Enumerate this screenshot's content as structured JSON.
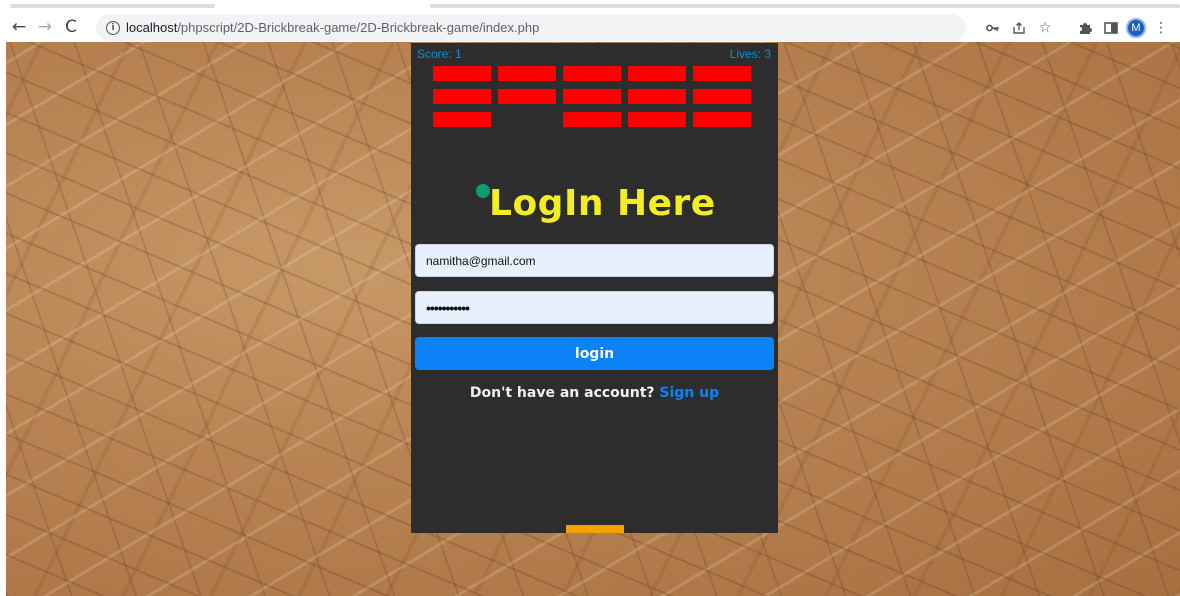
{
  "browser": {
    "icons": {
      "back": "arrow-left-icon",
      "forward": "arrow-right-icon",
      "reload": "reload-icon",
      "site_info": "info-icon",
      "password": "key-icon",
      "share": "share-icon",
      "bookmark": "star-icon",
      "extensions": "puzzle-icon",
      "side_panel": "side-panel-icon",
      "menu": "kebab-menu-icon"
    },
    "url_host": "localhost",
    "url_path": "/phpscript/2D-Brickbreak-game/2D-Brickbreak-game/index.php",
    "profile_initial": "M"
  },
  "game": {
    "score_label": "Score: 1",
    "lives_label": "Lives: 3",
    "colors": {
      "panel": "#2d2d2d",
      "brick": "#ff0000",
      "ball": "#109b72",
      "paddle": "#f5a200",
      "hud_text": "#0a8fd6",
      "title": "#f3ee24",
      "button": "#0b82f5"
    }
  },
  "login": {
    "title": "LogIn Here",
    "email_value": "namitha@gmail.com",
    "password_value": "•••••••••••",
    "login_button": "login",
    "signup_prompt": "Don't have an account?",
    "signup_link": "Sign up"
  }
}
